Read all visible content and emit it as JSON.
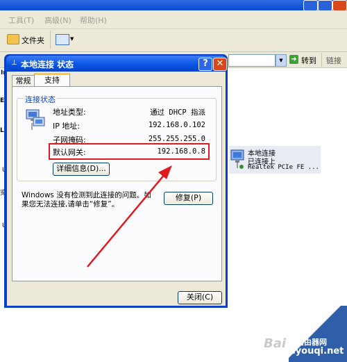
{
  "menu": {
    "tools": "工具(T)",
    "advanced": "高级(N)",
    "help": "帮助(H)"
  },
  "toolbar": {
    "folders": "文件夹"
  },
  "addressbar": {
    "go": "转到",
    "links": "链接"
  },
  "dialog": {
    "title": "本地连接 状态",
    "tabs": [
      {
        "label": "常规"
      },
      {
        "label": "支持"
      }
    ],
    "group_title": "连接状态",
    "rows": [
      {
        "label": "地址类型:",
        "value": "通过 DHCP 指派"
      },
      {
        "label": "IP 地址:",
        "value": "192.168.0.102"
      },
      {
        "label": "子网掩码:",
        "value": "255.255.255.0"
      },
      {
        "label": "默认网关:",
        "value": "192.168.0.8"
      }
    ],
    "details_button": "详细信息(D)...",
    "info_text": "Windows 没有检测到此连接的问题。如果您无法连接,请单击“修复”。",
    "repair_button": "修复(P)",
    "close_button": "关闭(C)",
    "help_glyph": "?",
    "close_glyph": "✕"
  },
  "connection": {
    "name": "本地连接",
    "status": "已连接上",
    "adapter": "Realtek PCIe FE ..."
  },
  "side_labels": [
    "Ir",
    "Eth",
    "LA",
    "U",
    "览",
    "U"
  ],
  "watermark": {
    "brand": "Bai",
    "site_cn": "路由器网",
    "site_url": "luyouqi.net"
  },
  "colors": {
    "highlight": "#e0191e",
    "xp_blue": "#0854e3"
  }
}
